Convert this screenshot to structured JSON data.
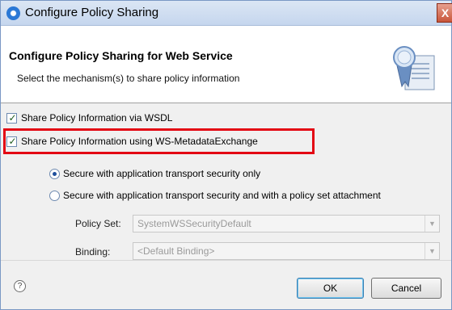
{
  "window": {
    "title": "Configure Policy Sharing",
    "close_label": "X"
  },
  "header": {
    "title": "Configure Policy Sharing for Web Service",
    "description": "Select the mechanism(s) to share policy information",
    "icon": "certificate-document-icon"
  },
  "options": {
    "wsdl": {
      "label": "Share Policy Information via WSDL",
      "checked": true
    },
    "mex": {
      "label": "Share Policy Information using WS-MetadataExchange",
      "checked": true,
      "highlight_color": "#e30613"
    }
  },
  "security": {
    "transport_only": {
      "label": "Secure with application transport security only",
      "selected": true
    },
    "with_policy_set": {
      "label": "Secure with application transport security and with a policy set attachment",
      "selected": false
    }
  },
  "fields": {
    "policy_set": {
      "label": "Policy Set:",
      "value": "SystemWSSecurityDefault",
      "enabled": false
    },
    "binding": {
      "label": "Binding:",
      "value": "<Default Binding>",
      "enabled": false
    }
  },
  "buttons": {
    "help": "?",
    "ok": "OK",
    "cancel": "Cancel"
  },
  "colors": {
    "title_gradient_top": "#dbe6f4",
    "accent": "#2a78d6",
    "highlight": "#e30613"
  }
}
